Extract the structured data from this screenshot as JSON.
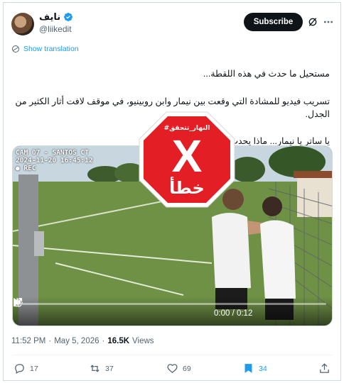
{
  "author": {
    "display_name": "نايف",
    "handle": "@liikedit",
    "verified": true
  },
  "header": {
    "subscribe_label": "Subscribe",
    "grok_icon": "grok-icon",
    "more_icon": "more-dots-icon"
  },
  "translation": {
    "label": "Show translation",
    "icon": "globe-icon"
  },
  "tweet": {
    "paragraph1": "مستحيل ما حدث في هذه اللقطة...",
    "paragraph2": "تسريب فيديو للمشادة التي وقعت بين نيمار وابن روبينيو، في موقف لافت أثار الكثير من الجدل.",
    "paragraph3": "يا ساتر يا نيمار... ماذا يحدث؟"
  },
  "media": {
    "cam_label": "CAM 07 - SANTOS CT",
    "cam_timestamp": "2024-11-20 16:45:12",
    "rec_label": "REC",
    "time": "0:00 / 0:12",
    "progress": 0.0
  },
  "stamp": {
    "hashtag": "#النهار_تتحقق",
    "mark": "X",
    "verdict": "خطأ",
    "color": "#e31e24"
  },
  "meta": {
    "time": "11:52 PM",
    "separator": "·",
    "date": "May 5, 2026",
    "views_count": "16.5K",
    "views_label": "Views"
  },
  "actions": {
    "replies": "17",
    "reposts": "37",
    "likes": "69",
    "bookmarks": "34"
  },
  "colors": {
    "accent": "#1d9bf0",
    "text": "#0f1419",
    "muted": "#536471"
  }
}
